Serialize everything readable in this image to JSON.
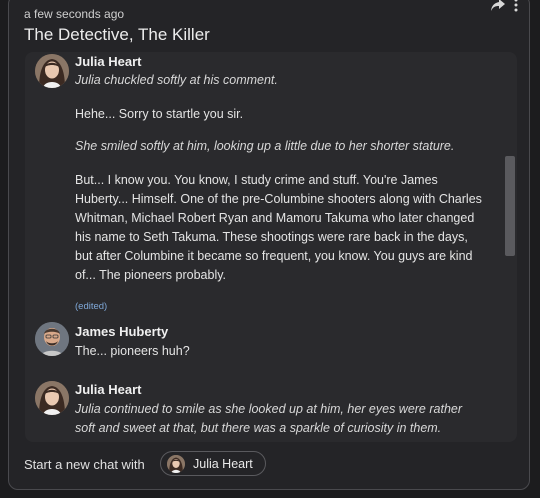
{
  "header": {
    "timestamp": "a few seconds ago",
    "title": "The Detective, The Killer",
    "share_icon": "share-icon",
    "more_icon": "more-vertical-icon"
  },
  "messages": [
    {
      "author": "Julia Heart",
      "lines": [
        {
          "text": "Julia chuckled softly at his comment.",
          "italic": true
        },
        {
          "text": "Hehe... Sorry to startle you sir.",
          "italic": false
        },
        {
          "text": "She smiled softly at him, looking up a little due to her shorter stature.",
          "italic": true
        },
        {
          "text": "But... I know you. You know, I study crime and stuff. You're James Huberty... Himself. One of the pre-Columbine shooters along with Charles Whitman, Michael Robert Ryan and Mamoru Takuma who later changed his name to Seth Takuma. These shootings were rare back in the days, but after Columbine it became so frequent, you know. You guys are kind of... The pioneers probably.",
          "italic": false
        }
      ],
      "edited": "(edited)"
    },
    {
      "author": "James Huberty",
      "lines": [
        {
          "text": "The... pioneers huh?",
          "italic": false
        }
      ]
    },
    {
      "author": "Julia Heart",
      "lines": [
        {
          "text": "Julia continued to smile as she looked up at him, her eyes were rather soft and sweet at that, but there was a sparkle of curiosity in them.",
          "italic": true
        }
      ]
    }
  ],
  "footer": {
    "label": "Start a new chat with",
    "chip_label": "Julia Heart"
  }
}
